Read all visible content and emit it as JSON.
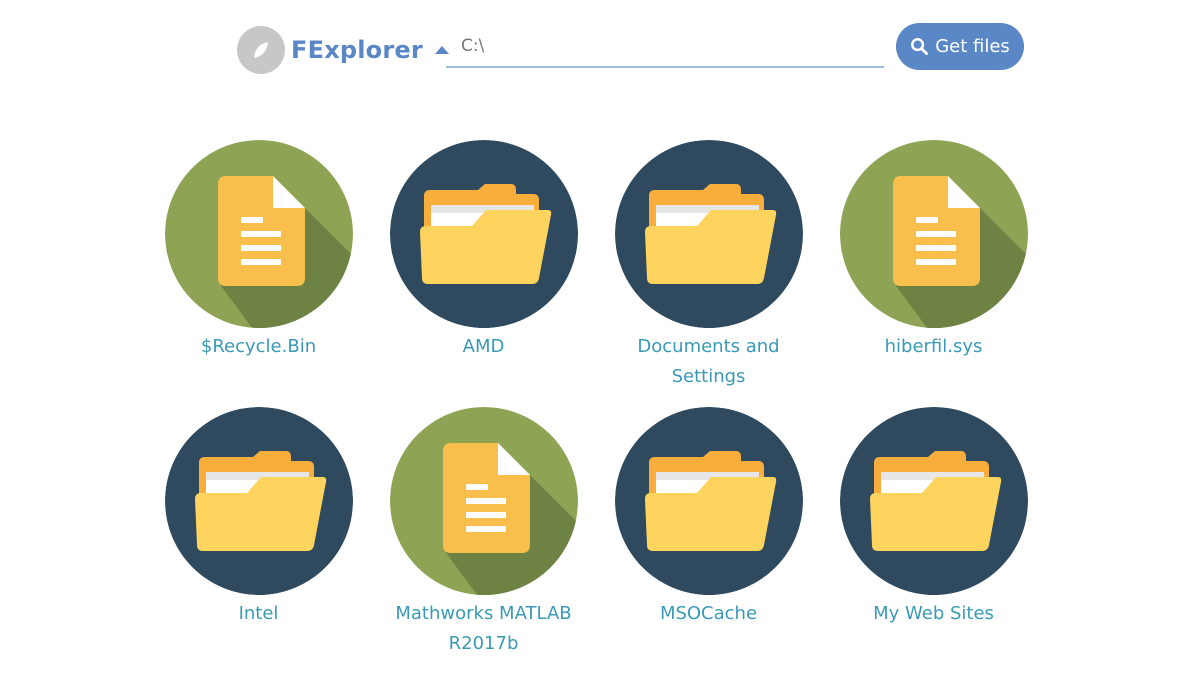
{
  "app": {
    "title": "FExplorer"
  },
  "search": {
    "path_value": "C:\\",
    "button_label": "Get files"
  },
  "colors": {
    "accent": "#5a87c5",
    "file_bg": "#8ea454",
    "folder_bg": "#2f4a5f",
    "label": "#3a9ab6"
  },
  "items": [
    {
      "name": "$Recycle.Bin",
      "type": "file",
      "icon": "file-icon"
    },
    {
      "name": "AMD",
      "type": "folder",
      "icon": "folder-icon"
    },
    {
      "name": "Documents and Settings",
      "type": "folder",
      "icon": "folder-icon"
    },
    {
      "name": "hiberfil.sys",
      "type": "file",
      "icon": "file-icon"
    },
    {
      "name": "Intel",
      "type": "folder",
      "icon": "folder-icon"
    },
    {
      "name": "Mathworks MATLAB R2017b",
      "type": "file",
      "icon": "file-icon"
    },
    {
      "name": "MSOCache",
      "type": "folder",
      "icon": "folder-icon"
    },
    {
      "name": "My Web Sites",
      "type": "folder",
      "icon": "folder-icon"
    }
  ]
}
